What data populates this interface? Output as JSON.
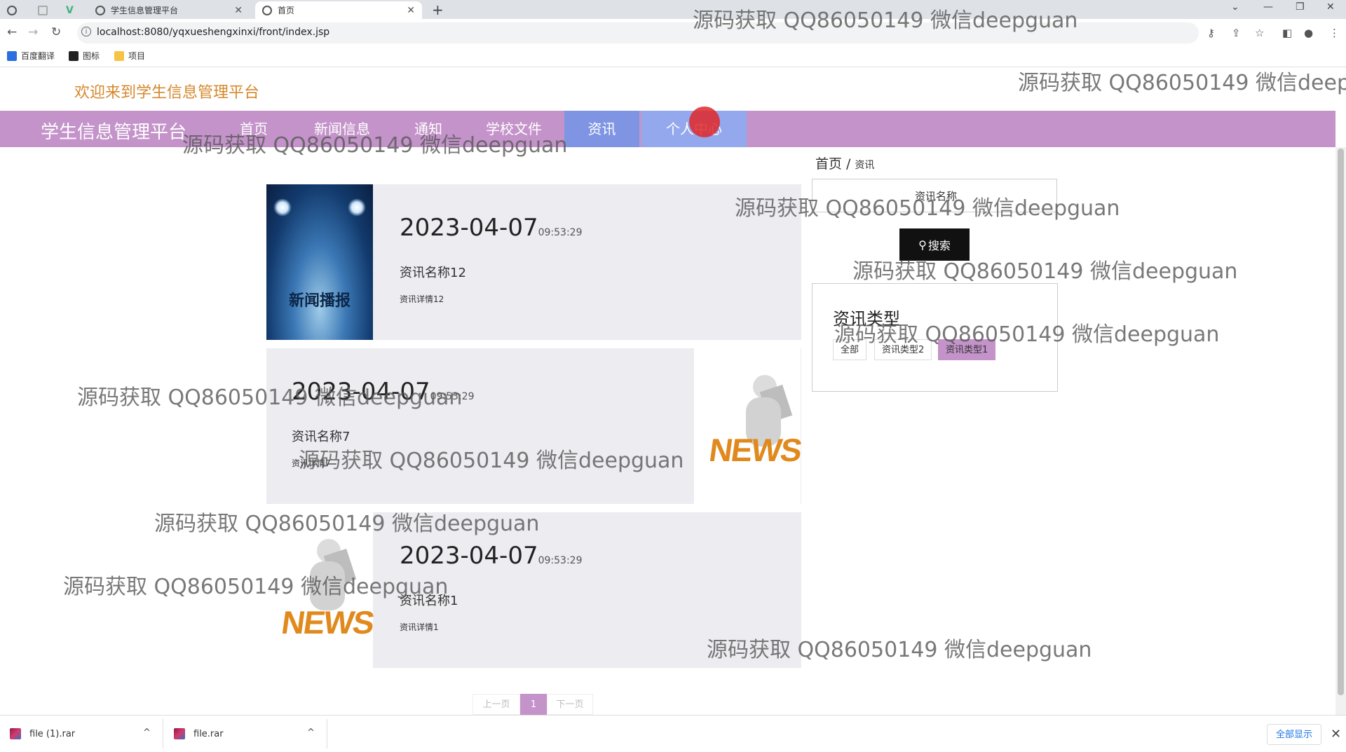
{
  "browser": {
    "tabs": [
      {
        "label": "",
        "icon": "globe-icon"
      },
      {
        "label": "",
        "icon": "blank-page-icon"
      },
      {
        "label": "",
        "icon": "vue-icon"
      },
      {
        "label": "学生信息管理平台",
        "icon": "globe-icon"
      },
      {
        "label": "首页",
        "icon": "globe-icon"
      }
    ],
    "url": "localhost:8080/yqxueshengxinxi/front/index.jsp",
    "bookmarks": [
      {
        "label": "百度翻译",
        "icon": "translate-icon"
      },
      {
        "label": "图标",
        "icon": "image-icon"
      },
      {
        "label": "项目",
        "icon": "folder-icon"
      }
    ]
  },
  "site": {
    "welcome": "欢迎来到学生信息管理平台",
    "brand": "学生信息管理平台",
    "nav": [
      "首页",
      "新闻信息",
      "通知",
      "学校文件",
      "资讯",
      "个人中心"
    ],
    "active_nav": "资讯",
    "nav_bg_color": "#c393c9",
    "active_color": "#7f95e3"
  },
  "news": [
    {
      "date": "2023-04-07",
      "time": "09:53:29",
      "title": "资讯名称12",
      "detail": "资讯详情12",
      "image": "spotlight-news-image",
      "image_text": "新闻播报"
    },
    {
      "date": "2023-04-07",
      "time": "09:53:29",
      "title": "资讯名称7",
      "detail": "资讯详情7",
      "image": "news-figure-image",
      "image_text": "NEWS"
    },
    {
      "date": "2023-04-07",
      "time": "09:53:29",
      "title": "资讯名称1",
      "detail": "资讯详情1",
      "image": "news-figure-image",
      "image_text": "NEWS"
    }
  ],
  "sidebar": {
    "breadcrumb_home": "首页",
    "breadcrumb_sep": "/",
    "breadcrumb_current": "资讯",
    "search_placeholder": "资讯名称",
    "search_button": "搜索",
    "types_title": "资讯类型",
    "types": [
      "全部",
      "资讯类型2",
      "资讯类型1"
    ],
    "active_type": "资讯类型1"
  },
  "pager": {
    "prev": "上一页",
    "current": "1",
    "next": "下一页"
  },
  "downloads": {
    "items": [
      "file (1).rar",
      "file.rar"
    ],
    "show_all": "全部显示"
  },
  "watermark": "源码获取 QQ86050149 微信deepguan"
}
